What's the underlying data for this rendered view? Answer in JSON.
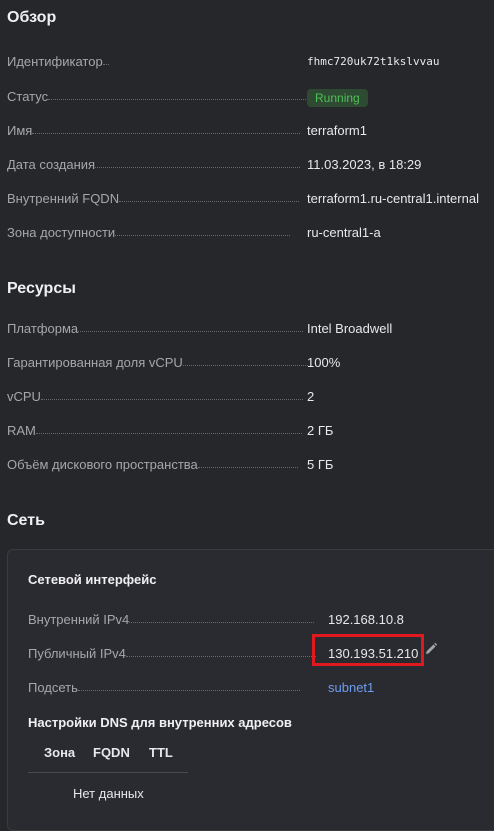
{
  "overview": {
    "title": "Обзор",
    "rows": [
      {
        "label": "Идентификатор",
        "value": "fhmc720uk72t1kslvvau"
      },
      {
        "label": "Статус",
        "value": "Running"
      },
      {
        "label": "Имя",
        "value": "terraform1"
      },
      {
        "label": "Дата создания",
        "value": "11.03.2023, в 18:29"
      },
      {
        "label": "Внутренний FQDN",
        "value": "terraform1.ru-central1.internal"
      },
      {
        "label": "Зона доступности",
        "value": "ru-central1-a"
      }
    ]
  },
  "resources": {
    "title": "Ресурсы",
    "rows": [
      {
        "label": "Платформа",
        "value": "Intel Broadwell"
      },
      {
        "label": "Гарантированная доля vCPU",
        "value": "100%"
      },
      {
        "label": "vCPU",
        "value": "2"
      },
      {
        "label": "RAM",
        "value": "2 ГБ"
      },
      {
        "label": "Объём дискового пространства",
        "value": "5 ГБ"
      }
    ]
  },
  "network": {
    "title": "Сеть",
    "interface": {
      "title": "Сетевой интерфейс",
      "rows": [
        {
          "label": "Внутренний IPv4",
          "value": "192.168.10.8"
        },
        {
          "label": "Публичный IPv4",
          "value": "130.193.51.210"
        },
        {
          "label": "Подсеть",
          "value": "subnet1"
        }
      ]
    },
    "dns": {
      "title": "Настройки DNS для внутренних адресов",
      "columns": [
        "Зона",
        "FQDN",
        "TTL"
      ],
      "empty": "Нет данных"
    }
  },
  "colors": {
    "status_running": "#4fbf57",
    "link": "#6e9cf0",
    "highlight": "#e0191e"
  },
  "icons": {
    "edit": "pencil-icon"
  }
}
